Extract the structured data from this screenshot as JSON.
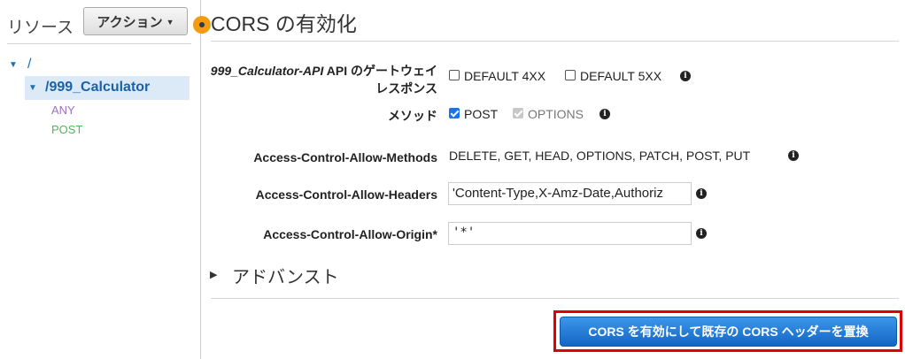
{
  "sidebar": {
    "title": "リソース",
    "actions_label": "アクション",
    "tree": {
      "root_label": "/",
      "selected_label": "/999_Calculator",
      "methods": [
        "ANY",
        "POST"
      ]
    }
  },
  "main": {
    "title": "CORS の有効化",
    "gateway_label_italic": "999_Calculator-API",
    "gateway_label_rest": " API のゲートウェイレスポンス",
    "gateway_options": [
      {
        "label": "DEFAULT 4XX",
        "checked": false
      },
      {
        "label": "DEFAULT 5XX",
        "checked": false
      }
    ],
    "method_label": "メソッド",
    "method_options": [
      {
        "label": "POST",
        "checked": true,
        "disabled": false
      },
      {
        "label": "OPTIONS",
        "checked": true,
        "disabled": true
      }
    ],
    "allow_methods_label": "Access-Control-Allow-Methods",
    "allow_methods_value": "DELETE, GET, HEAD, OPTIONS, PATCH, POST, PUT",
    "allow_headers_label": "Access-Control-Allow-Headers",
    "allow_headers_value": "'Content-Type,X-Amz-Date,Authoriz",
    "allow_origin_label": "Access-Control-Allow-Origin*",
    "allow_origin_value": "'*'",
    "advanced_label": "アドバンスト",
    "submit_label": "CORS を有効にして既存の CORS ヘッダーを置換"
  },
  "colors": {
    "accent_blue": "#1366c4",
    "highlight_red": "#e00000",
    "status_dot": "#f39c12"
  }
}
